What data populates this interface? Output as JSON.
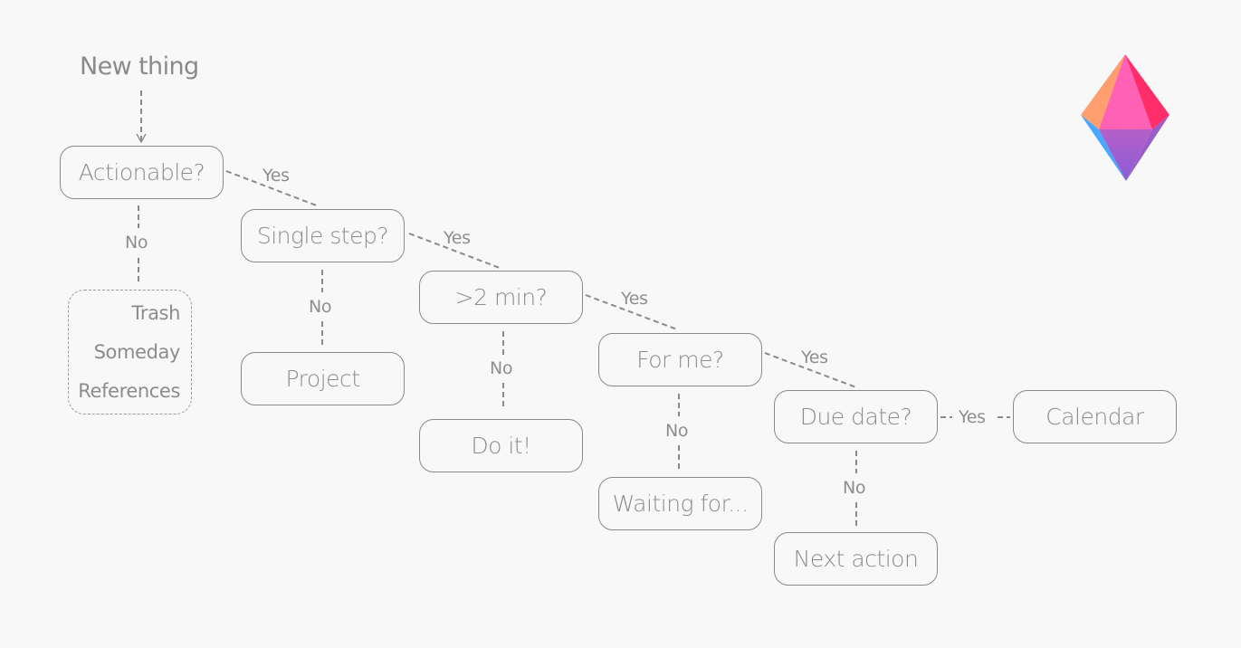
{
  "diagram": {
    "start": "New thing",
    "nodes": {
      "actionable": "Actionable?",
      "single_step": "Single step?",
      "two_min": ">2 min?",
      "for_me": "For me?",
      "due_date": "Due date?",
      "calendar": "Calendar",
      "project": "Project",
      "do_it": "Do it!",
      "waiting_for": "Waiting for...",
      "next_action": "Next action"
    },
    "bin": [
      "Trash",
      "Someday",
      "References"
    ],
    "edge_labels": {
      "yes": "Yes",
      "no": "No"
    },
    "edges": [
      {
        "from": "New thing",
        "to": "Actionable?",
        "label": ""
      },
      {
        "from": "Actionable?",
        "to": "Single step?",
        "label": "Yes"
      },
      {
        "from": "Actionable?",
        "to": "Trash / Someday / References",
        "label": "No"
      },
      {
        "from": "Single step?",
        "to": ">2 min?",
        "label": "Yes"
      },
      {
        "from": "Single step?",
        "to": "Project",
        "label": "No"
      },
      {
        "from": ">2 min?",
        "to": "For me?",
        "label": "Yes"
      },
      {
        "from": ">2 min?",
        "to": "Do it!",
        "label": "No"
      },
      {
        "from": "For me?",
        "to": "Due date?",
        "label": "Yes"
      },
      {
        "from": "For me?",
        "to": "Waiting for...",
        "label": "No"
      },
      {
        "from": "Due date?",
        "to": "Calendar",
        "label": "Yes"
      },
      {
        "from": "Due date?",
        "to": "Next action",
        "label": "No"
      }
    ],
    "logo": {
      "name": "gem-logo",
      "colors": {
        "left_upper": "#ff9e6e",
        "front_upper": "#ff62b4",
        "right_upper": "#ff2d6a",
        "left_lower": "#48a8ff",
        "front_lower_top": "#b45fc8",
        "front_lower_bottom": "#8a5ed6",
        "right_lower": "#9a5cc6"
      }
    }
  }
}
